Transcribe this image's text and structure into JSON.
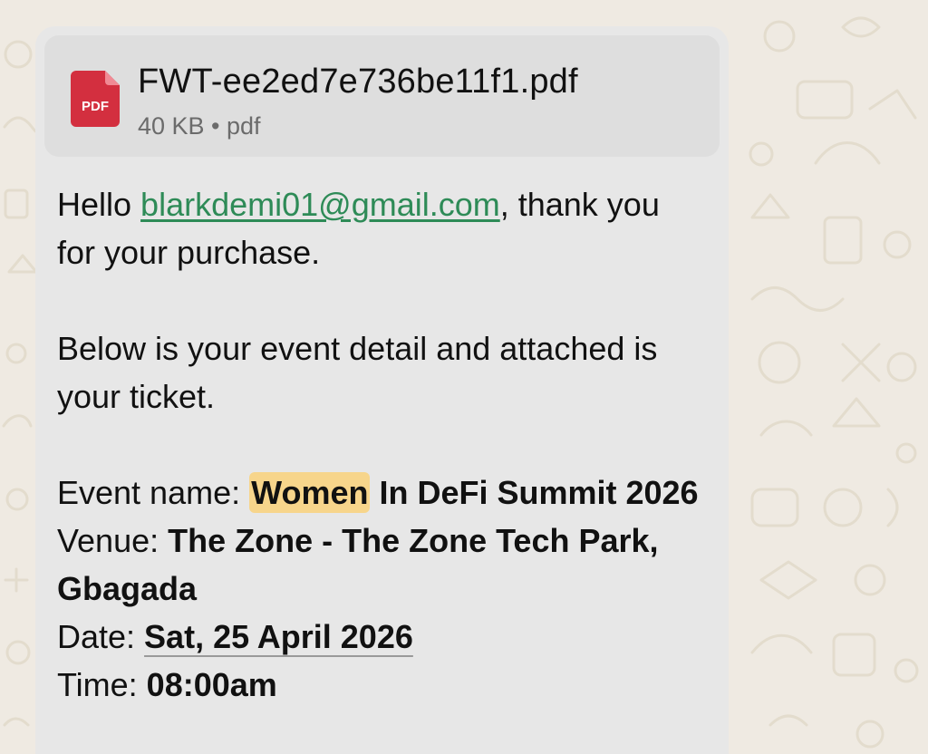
{
  "attachment": {
    "icon": "pdf-file-icon",
    "icon_label": "PDF",
    "icon_color": "#d32f3f",
    "file_name": "FWT-ee2ed7e736be11f1.pdf",
    "file_meta": "40 KB • pdf"
  },
  "message": {
    "greeting_prefix": "Hello ",
    "email": "blarkdemi01@gmail.com",
    "greeting_suffix": ", thank you for your purchase.",
    "paragraph2": "Below is your event detail and attached is your ticket.",
    "event_name_label": "Event name: ",
    "event_name_highlighted": "Women",
    "event_name_rest": " In DeFi Summit 2026",
    "venue_label": "Venue: ",
    "venue_value": "The Zone - The Zone Tech Park, Gbagada",
    "date_label": "Date: ",
    "date_value": "Sat, 25 April 2026",
    "time_label": "Time: ",
    "time_value": "08:00am"
  },
  "colors": {
    "wallpaper": "#efeae2",
    "bubble": "#e7e7e7",
    "attachment_bg": "#dedede",
    "link": "#2e8b57",
    "search_highlight": "#f7d58b"
  }
}
